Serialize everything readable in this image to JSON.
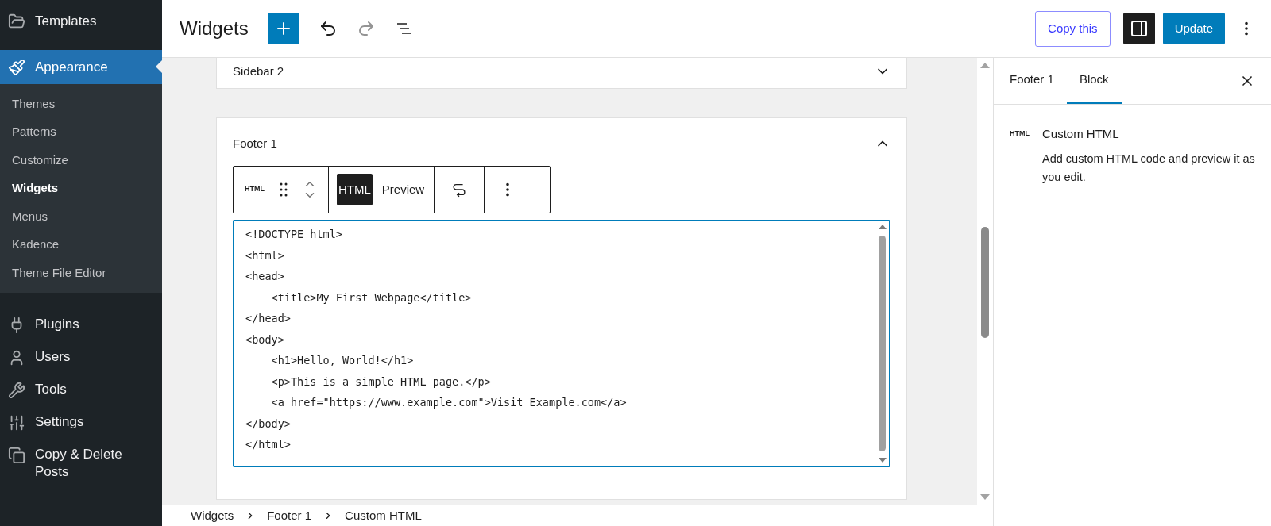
{
  "admin_menu": {
    "top": [
      {
        "label": "Templates",
        "current": false
      },
      {
        "label": "Appearance",
        "current": true
      }
    ],
    "submenu": [
      {
        "label": "Themes",
        "selected": false
      },
      {
        "label": "Patterns",
        "selected": false
      },
      {
        "label": "Customize",
        "selected": false
      },
      {
        "label": "Widgets",
        "selected": true
      },
      {
        "label": "Menus",
        "selected": false
      },
      {
        "label": "Kadence",
        "selected": false
      },
      {
        "label": "Theme File Editor",
        "selected": false
      }
    ],
    "bottom": [
      {
        "label": "Plugins"
      },
      {
        "label": "Users"
      },
      {
        "label": "Tools"
      },
      {
        "label": "Settings"
      },
      {
        "label": "Copy & Delete Posts"
      }
    ]
  },
  "header": {
    "title": "Widgets",
    "redo_disabled": true,
    "copy_button": "Copy this",
    "settings_active": true,
    "update_button": "Update"
  },
  "widget_areas": [
    {
      "title": "Sidebar 2",
      "expanded": false
    },
    {
      "title": "Footer 1",
      "expanded": true,
      "block": {
        "type_label": "HTML",
        "modes": [
          {
            "label": "HTML",
            "selected": true
          },
          {
            "label": "Preview",
            "selected": false
          }
        ],
        "code": [
          "<!DOCTYPE html>",
          "<html>",
          "<head>",
          "    <title>My First Webpage</title>",
          "</head>",
          "<body>",
          "    <h1>Hello, World!</h1>",
          "    <p>This is a simple HTML page.</p>",
          "    <a href=\"https://www.example.com\">Visit Example.com</a>",
          "</body>",
          "</html>"
        ]
      }
    }
  ],
  "inspector": {
    "tabs": [
      {
        "label": "Footer 1",
        "selected": false
      },
      {
        "label": "Block",
        "selected": true
      }
    ],
    "block_icon": "HTML",
    "block_title": "Custom HTML",
    "block_description": "Add custom HTML code and preview it as you edit."
  },
  "breadcrumb": [
    "Widgets",
    "Footer 1",
    "Custom HTML"
  ]
}
